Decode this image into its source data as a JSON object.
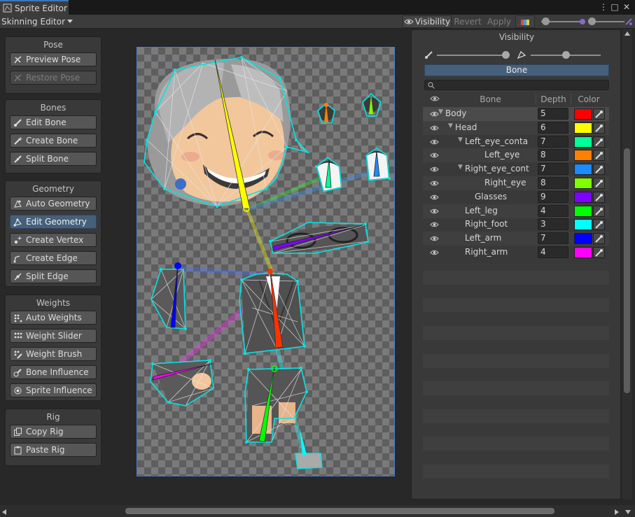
{
  "window": {
    "tab_title": "Sprite Editor",
    "menu_dots": "⋮",
    "maximize": "□",
    "close": "✕"
  },
  "toolbar": {
    "mode": "Skinning Editor",
    "visibility_label": "Visibility",
    "revert_label": "Revert",
    "apply_label": "Apply"
  },
  "left_panels": {
    "pose": {
      "title": "Pose",
      "buttons": [
        "Preview Pose",
        "Restore Pose"
      ]
    },
    "bones": {
      "title": "Bones",
      "buttons": [
        "Edit Bone",
        "Create Bone",
        "Split Bone"
      ]
    },
    "geometry": {
      "title": "Geometry",
      "buttons": [
        "Auto Geometry",
        "Edit Geometry",
        "Create Vertex",
        "Create Edge",
        "Split Edge"
      ]
    },
    "weights": {
      "title": "Weights",
      "buttons": [
        "Auto Weights",
        "Weight Slider",
        "Weight Brush",
        "Bone Influence",
        "Sprite Influence"
      ]
    },
    "rig": {
      "title": "Rig",
      "buttons": [
        "Copy Rig",
        "Paste Rig"
      ]
    }
  },
  "visibility_panel": {
    "title": "Visibility",
    "active_tab": "Bone",
    "columns": {
      "bone": "Bone",
      "depth": "Depth",
      "color": "Color"
    },
    "bones": [
      {
        "name": "Body",
        "depth": "5",
        "color": "#ff0000",
        "level": 0,
        "expanded": true
      },
      {
        "name": "Head",
        "depth": "6",
        "color": "#ffff00",
        "level": 1,
        "expanded": true
      },
      {
        "name": "Left_eye_conta",
        "depth": "7",
        "color": "#00ff99",
        "level": 2,
        "expanded": true
      },
      {
        "name": "Left_eye",
        "depth": "8",
        "color": "#ff8000",
        "level": 3
      },
      {
        "name": "Right_eye_cont",
        "depth": "7",
        "color": "#1a8cff",
        "level": 2,
        "expanded": true
      },
      {
        "name": "Right_eye",
        "depth": "8",
        "color": "#80ff00",
        "level": 3
      },
      {
        "name": "Glasses",
        "depth": "9",
        "color": "#8000ff",
        "level": 2
      },
      {
        "name": "Left_leg",
        "depth": "4",
        "color": "#00ff00",
        "level": 1
      },
      {
        "name": "Right_foot",
        "depth": "3",
        "color": "#00ffff",
        "level": 1
      },
      {
        "name": "Left_arm",
        "depth": "7",
        "color": "#0000ff",
        "level": 1
      },
      {
        "name": "Right_arm",
        "depth": "4",
        "color": "#ff00ff",
        "level": 1
      }
    ]
  },
  "colors": {
    "accent": "#46607c",
    "mesh_outline": "#00e5e5",
    "canvas_border": "#4d7dcc"
  }
}
